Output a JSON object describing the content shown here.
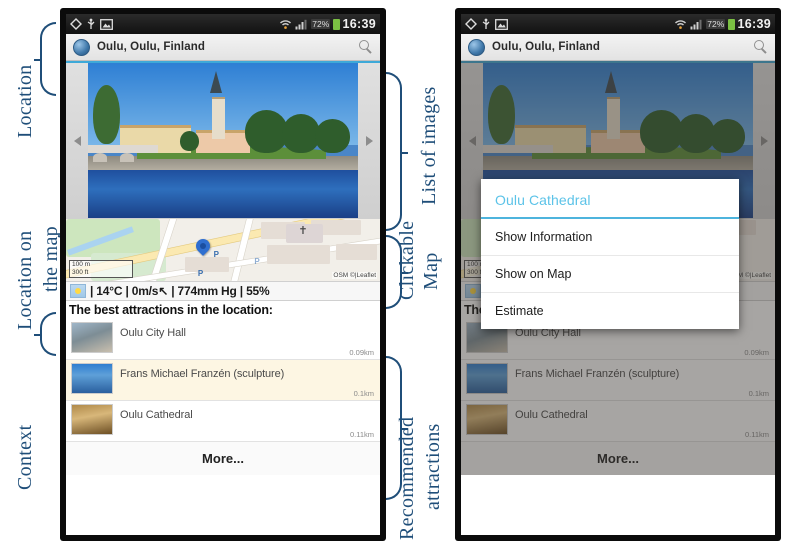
{
  "annotations": {
    "left": [
      {
        "label": "Location"
      },
      {
        "label": "Location on"
      },
      {
        "label": "the map"
      },
      {
        "label": "Context"
      }
    ],
    "right": [
      {
        "label": "List of images"
      },
      {
        "label": "Clickable"
      },
      {
        "label": "Map"
      },
      {
        "label": "Recommended"
      },
      {
        "label": "attractions"
      }
    ]
  },
  "status_bar": {
    "time": "16:39",
    "battery_percent": "72%",
    "icons": [
      "gps-icon",
      "usb-icon",
      "gallery-icon",
      "wifi-icon",
      "signal-icon",
      "battery-icon"
    ]
  },
  "header": {
    "title": "Oulu, Oulu, Finland",
    "globe_icon": "globe-icon",
    "search_icon": "search-icon"
  },
  "carousel": {
    "prev_label": "◀",
    "next_label": "▶"
  },
  "map": {
    "scale_metric": "100 m",
    "scale_imperial": "300 ft",
    "attribution": "OSM ©|Leaflet",
    "pin_icon": "map-pin-icon",
    "church_icon": "church-cross-icon",
    "parking_label": "P"
  },
  "context": {
    "weather_icon": "sun-icon",
    "text": "| 14°C | 0m/s↖ | 774mm Hg | 55%",
    "temperature": "14°C",
    "wind": "0m/s",
    "pressure": "774mm Hg",
    "humidity": "55%"
  },
  "attractions": {
    "heading": "The best attractions in the location:",
    "items": [
      {
        "name": "Oulu City Hall",
        "distance": "0.09km",
        "highlighted": false
      },
      {
        "name": "Frans Michael Franzén (sculpture)",
        "distance": "0.1km",
        "highlighted": true
      },
      {
        "name": "Oulu Cathedral",
        "distance": "0.11km",
        "highlighted": false
      }
    ],
    "more_label": "More..."
  },
  "dialog": {
    "title": "Oulu Cathedral",
    "options": [
      "Show Information",
      "Show on Map",
      "Estimate"
    ]
  },
  "colors": {
    "accent_blue": "#5cc3e8",
    "annotation": "#1F4E79",
    "highlight_row": "#fdf6e3",
    "battery_green": "#7bc043"
  }
}
